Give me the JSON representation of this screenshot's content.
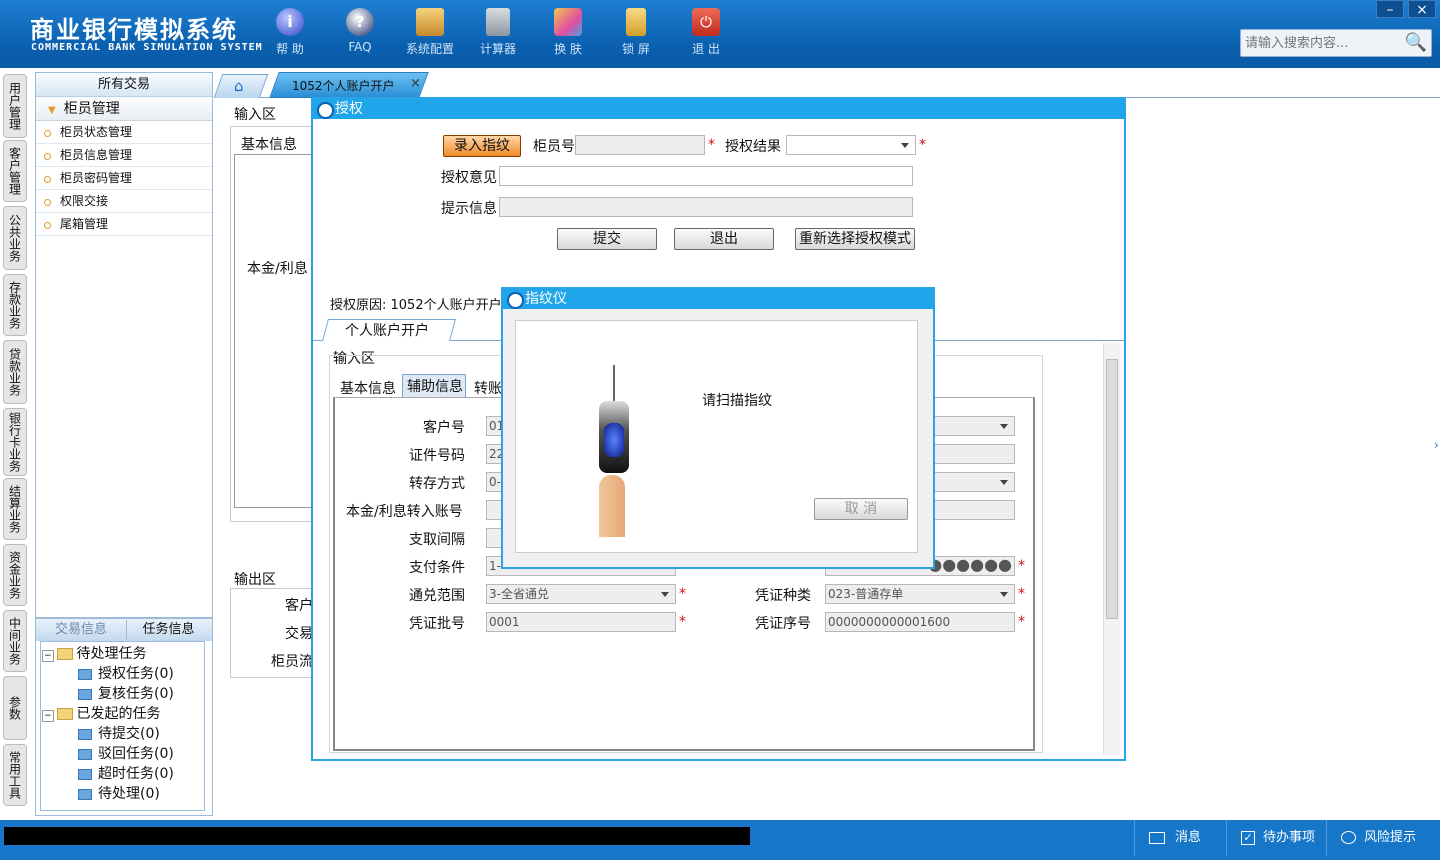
{
  "app": {
    "title_cn": "商业银行模拟系统",
    "title_en": "COMMERCIAL BANK SIMULATION SYSTEM"
  },
  "toolbar": [
    {
      "label": "帮 助",
      "icon": "info-icon"
    },
    {
      "label": "FAQ",
      "icon": "help-icon"
    },
    {
      "label": "系统配置",
      "icon": "config-icon"
    },
    {
      "label": "计算器",
      "icon": "calculator-icon"
    },
    {
      "label": "换 肤",
      "icon": "skin-icon"
    },
    {
      "label": "锁 屏",
      "icon": "lock-icon"
    },
    {
      "label": "退 出",
      "icon": "power-icon"
    }
  ],
  "search": {
    "placeholder": "请输入搜索内容..."
  },
  "vnav": [
    "用户管理",
    "客户管理",
    "公共业务",
    "存款业务",
    "贷款业务",
    "银行卡业务",
    "结算业务",
    "资金业务",
    "中间业务",
    "参数",
    "常用工具"
  ],
  "sidebar": {
    "header": "所有交易",
    "group": "柜员管理",
    "items": [
      "柜员状态管理",
      "柜员信息管理",
      "柜员密码管理",
      "权限交接",
      "尾箱管理"
    ]
  },
  "tasks": {
    "tab1": "交易信息",
    "tab2": "任务信息",
    "pending": "待处理任务",
    "auth": "授权任务(0)",
    "review": "复核任务(0)",
    "initiated": "已发起的任务",
    "to_submit": "待提交(0)",
    "rejected": "驳回任务(0)",
    "timeout": "超时任务(0)",
    "to_process": "待处理(0)"
  },
  "tabs": {
    "current": "1052个人账户开户",
    "close": "×"
  },
  "bg": {
    "input_area": "输入区",
    "basic_info": "基本信息",
    "principal": "本金/利息",
    "output_area": "输出区",
    "customer": "客户",
    "trans": "交易",
    "teller_flow": "柜员流"
  },
  "auth": {
    "title": "授权",
    "btn_record": "录入指纹",
    "teller_no": "柜员号",
    "auth_result": "授权结果",
    "opinion": "授权意见",
    "hint": "提示信息",
    "submit": "提交",
    "exit": "退出",
    "reselect": "重新选择授权模式",
    "reason": "授权原因: 1052个人账户开户",
    "subtab": "个人账户开户",
    "input_area": "输入区",
    "tab_basic": "基本信息",
    "tab_aux": "辅助信息",
    "tab_transfer": "转账"
  },
  "form": {
    "cust_no": "客户号",
    "cust_no_val": "01",
    "id_no": "证件号码",
    "id_no_val": "22",
    "transfer_mode": "转存方式",
    "transfer_mode_val": "0-",
    "principal_acct": "本金/利息转入账号",
    "interval": "支取间隔",
    "pay_cond": "支付条件",
    "pay_cond_val": "1-",
    "range": "通兑范围",
    "range_val": "3-全省通兑",
    "batch": "凭证批号",
    "batch_val": "0001",
    "voucher_type": "凭证种类",
    "voucher_type_val": "023-普通存单",
    "voucher_seq": "凭证序号",
    "voucher_seq_val": "0000000000001600",
    "password_dots": "●●●●●●"
  },
  "fingerprint": {
    "title": "指纹仪",
    "message": "请扫描指纹",
    "cancel": "取 消"
  },
  "status": {
    "msg": "消息",
    "todo": "待办事项",
    "risk": "风险提示"
  }
}
